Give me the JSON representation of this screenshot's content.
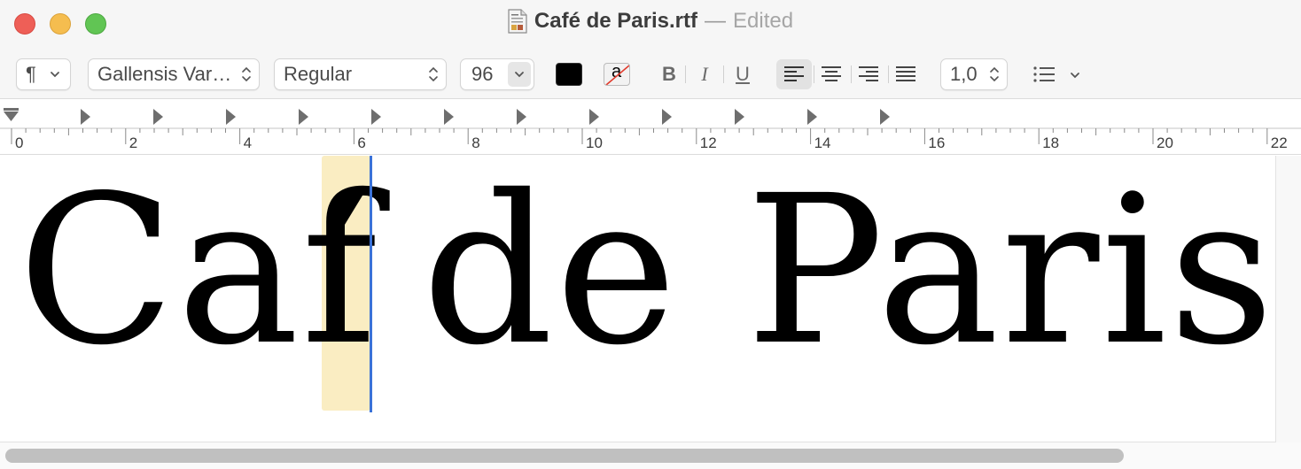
{
  "window": {
    "title": "Café de Paris.rtf",
    "separator": "—",
    "status": "Edited",
    "doc_icon": "rtf-document-icon"
  },
  "toolbar": {
    "paragraph_styles": {
      "icon": "pilcrow-icon",
      "label": "¶"
    },
    "font_family": "Gallensis Var…",
    "font_style": "Regular",
    "font_size": "96",
    "text_color": "#000000",
    "highlight_icon": "no-background-color-icon",
    "highlight_label": "a",
    "bold_label": "B",
    "italic_label": "I",
    "underline_label": "U",
    "alignment": [
      "left",
      "center",
      "right",
      "justify"
    ],
    "alignment_selected": "left",
    "line_spacing": "1,0",
    "list_icon": "bulleted-list-icon"
  },
  "ruler": {
    "labels": [
      "0",
      "2",
      "4",
      "6",
      "8",
      "10",
      "12",
      "14",
      "16",
      "18",
      "20",
      "22"
    ]
  },
  "document": {
    "text_before": "Caf",
    "text_after": "de Paris",
    "selected_char": "´",
    "highlight_color": "#faedc2",
    "caret_color": "#3a72d8"
  }
}
